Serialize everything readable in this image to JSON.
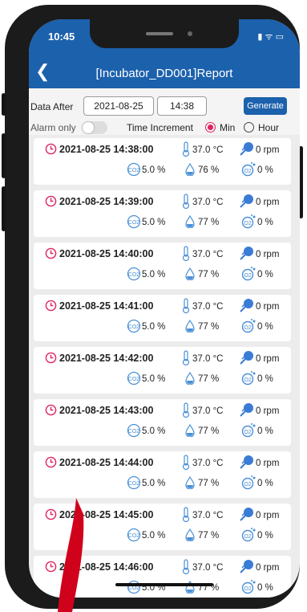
{
  "status_bar": {
    "time": "10:45",
    "icons": "▮ ᯤ ▭"
  },
  "header": {
    "back_icon": "chevron-left-icon",
    "title": "[Incubator_DD001]Report"
  },
  "filter": {
    "data_after_label": "Data After",
    "date": "2021-08-25",
    "time": "14:38",
    "generate_label": "Generate",
    "alarm_only_label": "Alarm only",
    "time_increment_label": "Time Increment",
    "min_label": "Min",
    "hour_label": "Hour",
    "selected_increment": "Min"
  },
  "colors": {
    "brand": "#1c61ac",
    "accent": "#e0245e"
  },
  "records": [
    {
      "timestamp": "2021-08-25 14:38:00",
      "temp": "37.0 °C",
      "rpm": "0 rpm",
      "co2": "5.0 %",
      "humidity": "76 %",
      "o2": "0 %"
    },
    {
      "timestamp": "2021-08-25 14:39:00",
      "temp": "37.0 °C",
      "rpm": "0 rpm",
      "co2": "5.0 %",
      "humidity": "77 %",
      "o2": "0 %"
    },
    {
      "timestamp": "2021-08-25 14:40:00",
      "temp": "37.0 °C",
      "rpm": "0 rpm",
      "co2": "5.0 %",
      "humidity": "77 %",
      "o2": "0 %"
    },
    {
      "timestamp": "2021-08-25 14:41:00",
      "temp": "37.0 °C",
      "rpm": "0 rpm",
      "co2": "5.0 %",
      "humidity": "77 %",
      "o2": "0 %"
    },
    {
      "timestamp": "2021-08-25 14:42:00",
      "temp": "37.0 °C",
      "rpm": "0 rpm",
      "co2": "5.0 %",
      "humidity": "77 %",
      "o2": "0 %"
    },
    {
      "timestamp": "2021-08-25 14:43:00",
      "temp": "37.0 °C",
      "rpm": "0 rpm",
      "co2": "5.0 %",
      "humidity": "77 %",
      "o2": "0 %"
    },
    {
      "timestamp": "2021-08-25 14:44:00",
      "temp": "37.0 °C",
      "rpm": "0 rpm",
      "co2": "5.0 %",
      "humidity": "77 %",
      "o2": "0 %"
    },
    {
      "timestamp": "2021-08-25 14:45:00",
      "temp": "37.0 °C",
      "rpm": "0 rpm",
      "co2": "5.0 %",
      "humidity": "77 %",
      "o2": "0 %"
    },
    {
      "timestamp": "2021-08-25 14:46:00",
      "temp": "37.0 °C",
      "rpm": "0 rpm",
      "co2": "5.0 %",
      "humidity": "77 %",
      "o2": "0 %"
    }
  ]
}
